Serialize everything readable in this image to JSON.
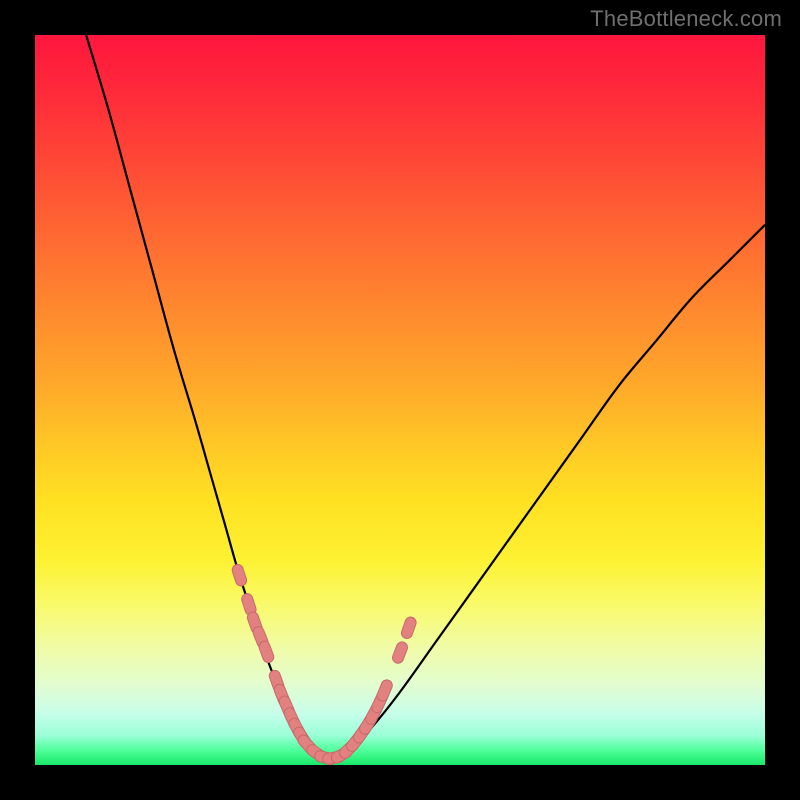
{
  "watermark": "TheBottleneck.com",
  "colors": {
    "curve_stroke": "#000000",
    "marker_fill": "#e38080",
    "marker_stroke": "#c76a6a"
  },
  "chart_data": {
    "type": "line",
    "title": "",
    "xlabel": "",
    "ylabel": "",
    "xlim": [
      0,
      100
    ],
    "ylim": [
      0,
      100
    ],
    "grid": false,
    "legend": false,
    "series": [
      {
        "name": "bottleneck-curve",
        "x": [
          7,
          10,
          13,
          16,
          19,
          22,
          24,
          26,
          28,
          30,
          32,
          34,
          35.5,
          37,
          38.5,
          40,
          43,
          46,
          50,
          55,
          60,
          65,
          70,
          75,
          80,
          85,
          90,
          95,
          100
        ],
        "y": [
          100,
          90,
          79,
          68,
          57,
          47,
          40,
          33,
          26,
          20,
          14,
          9,
          6,
          3.5,
          2,
          1,
          2,
          5,
          10,
          17,
          24,
          31,
          38,
          45,
          52,
          58,
          64,
          69,
          74
        ]
      }
    ],
    "markers": {
      "name": "highlight-markers",
      "x": [
        28.0,
        29.3,
        30.1,
        30.9,
        31.7,
        33.1,
        33.8,
        34.5,
        35.2,
        35.9,
        36.6,
        37.3,
        38.6,
        39.8,
        40.9,
        42.0,
        43.0,
        43.9,
        44.8,
        45.6,
        46.4,
        47.2,
        47.9,
        50.0,
        51.2
      ],
      "y": [
        26.0,
        22.0,
        19.5,
        17.5,
        15.5,
        11.5,
        9.6,
        8.0,
        6.4,
        5.0,
        3.8,
        2.8,
        1.6,
        1.0,
        1.0,
        1.4,
        2.2,
        3.2,
        4.4,
        5.6,
        7.0,
        8.6,
        10.2,
        15.4,
        18.8
      ]
    }
  }
}
